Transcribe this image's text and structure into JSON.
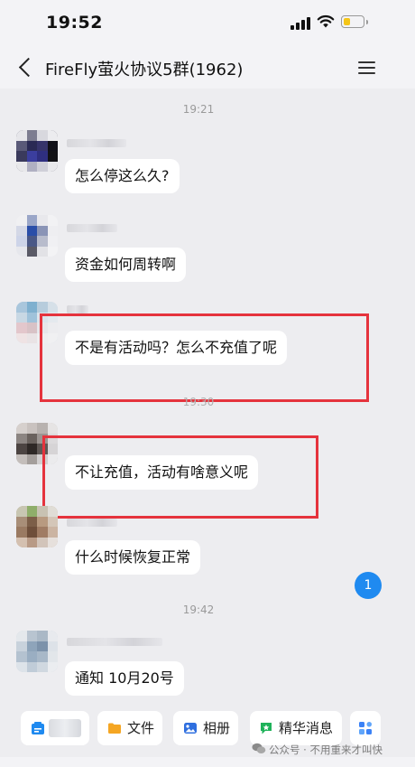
{
  "status_bar": {
    "time": "19:52"
  },
  "nav": {
    "title": "FireFly萤火协议5群(1962)"
  },
  "messages": [
    {
      "timestamp": "19:21",
      "text": "怎么停这么久?"
    },
    {
      "text": "资金如何周转啊"
    },
    {
      "text": "不是有活动吗？怎么不充值了呢",
      "highlighted": true
    },
    {
      "timestamp": "19:30",
      "text": "不让充值，活动有啥意义呢",
      "highlighted": true
    },
    {
      "text": "什么时候恢复正常"
    },
    {
      "timestamp": "19:42",
      "text": "通知 10月20号"
    }
  ],
  "unread_badge": "1",
  "toolbar": {
    "files_label": "文件",
    "album_label": "相册",
    "featured_label": "精华消息"
  },
  "watermark": "公众号 · 不用重来才叫快",
  "colors": {
    "highlight": "#e5333d",
    "badge": "#1f8af0",
    "background": "#ededf0"
  },
  "icons": [
    "back-arrow-icon",
    "menu-icon",
    "file-icon",
    "album-icon",
    "featured-icon",
    "apps-icon"
  ]
}
